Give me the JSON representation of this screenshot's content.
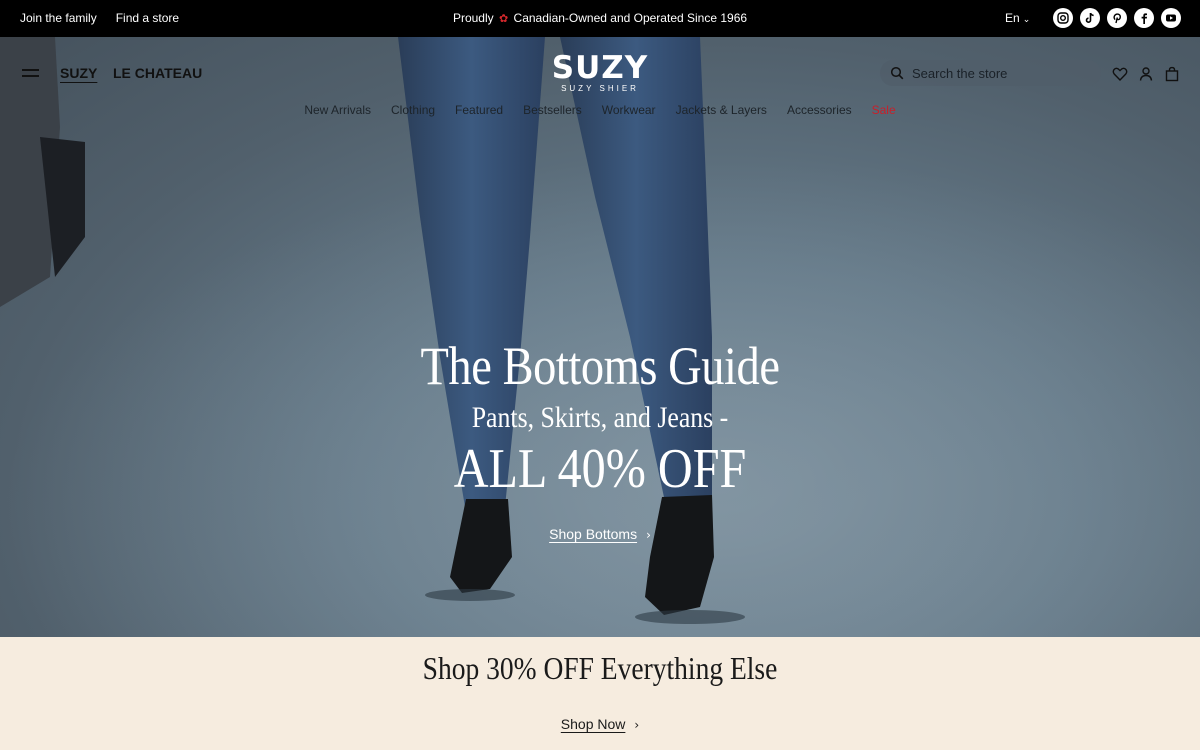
{
  "topbar": {
    "join_label": "Join the family",
    "store_label": "Find a store",
    "announcement_before": "Proudly",
    "announcement_after": "Canadian-Owned and Operated Since 1966",
    "leaf_icon": "maple-leaf-icon",
    "language": "En",
    "social": [
      {
        "name": "instagram-icon",
        "glyph": "◎"
      },
      {
        "name": "tiktok-icon",
        "glyph": "♪"
      },
      {
        "name": "pinterest-icon",
        "glyph": "P"
      },
      {
        "name": "facebook-icon",
        "glyph": "f"
      },
      {
        "name": "youtube-icon",
        "glyph": "▶"
      }
    ]
  },
  "header": {
    "brand_tabs": [
      "SUZY",
      "LE CHATEAU"
    ],
    "logo_main": "SUZY",
    "logo_sub": "SUZY SHIER",
    "search_placeholder": "Search the store",
    "icons": [
      "heart-icon",
      "account-icon",
      "bag-icon"
    ]
  },
  "nav": {
    "items": [
      "New Arrivals",
      "Clothing",
      "Featured",
      "Bestsellers",
      "Workwear",
      "Jackets & Layers",
      "Accessories",
      "Sale"
    ]
  },
  "hero": {
    "title": "The Bottoms Guide",
    "subtitle": "Pants, Skirts, and Jeans -",
    "offer": "ALL 40% OFF",
    "cta": "Shop Bottoms"
  },
  "promo": {
    "title": "Shop 30% OFF Everything Else",
    "cta": "Shop Now"
  },
  "colors": {
    "topbar_bg": "#000000",
    "promo_bg": "#f6ecdf",
    "sale": "#c8202a",
    "leaf": "#d6282c"
  }
}
